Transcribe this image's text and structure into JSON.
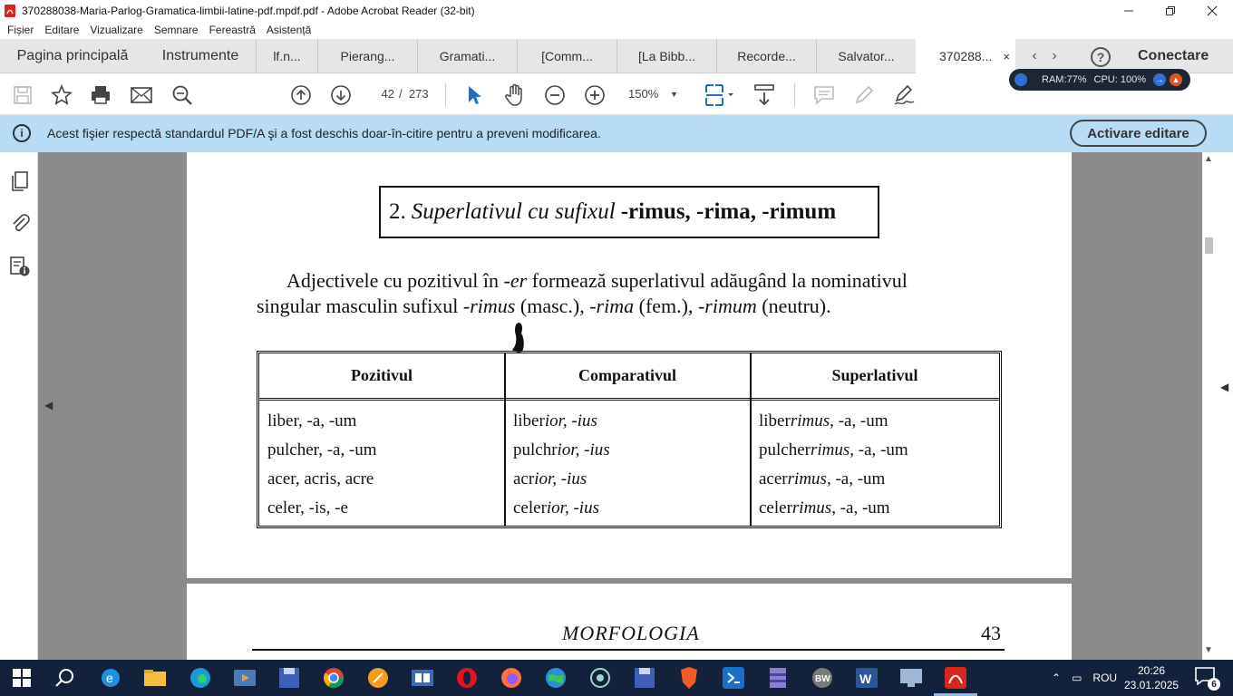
{
  "window": {
    "title": "370288038-Maria-Parlog-Gramatica-limbii-latine-pdf.mpdf.pdf - Adobe Acrobat Reader (32-bit)"
  },
  "menu": [
    "Fișier",
    "Editare",
    "Vizualizare",
    "Semnare",
    "Fereastră",
    "Asistență"
  ],
  "tabs": {
    "home": "Pagina principală",
    "tools": "Instrumente",
    "documents": [
      "lf.n...",
      "Pierang...",
      "Gramati...",
      "[Comm...",
      "[La Bibb...",
      "Recorde...",
      "Salvator...",
      "370288..."
    ],
    "active_index": 7,
    "close_glyph": "×",
    "connect": "Conectare"
  },
  "toolbar": {
    "page_current": "42",
    "page_sep": "/",
    "page_total": "273",
    "zoom": "150%"
  },
  "sysmon": {
    "ram": "RAM:77%",
    "cpu": "CPU: 100%"
  },
  "banner": {
    "message": "Acest fişier respectă standardul PDF/A şi a fost deschis doar-în-citire pentru a preveni modificarea.",
    "button": "Activare editare"
  },
  "page1": {
    "heading_num": "2.",
    "heading_italic": "Superlativul cu sufixul",
    "heading_bold": "-rimus, -rima, -rimum",
    "para": {
      "l1_a": "Adjectivele cu pozitivul în ",
      "l1_b": "-er",
      "l1_c": " formează superlativul adăugând la nominativul",
      "l2_a": "singular masculin sufixul ",
      "l2_b": "-rimus",
      "l2_c": " (masc.), ",
      "l2_d": "-rima",
      "l2_e": " (fem.), ",
      "l2_f": "-rimum",
      "l2_g": " (neutru)."
    },
    "table": {
      "headers": [
        "Pozitivul",
        "Comparativul",
        "Superlativul"
      ],
      "rows": [
        {
          "pos": "liber, -a, -um",
          "comp_stem": "liber",
          "comp_suf": "ior, -ius",
          "sup_stem": "liber",
          "sup_suf": "rimus",
          "sup_end": ", -a, -um"
        },
        {
          "pos": "pulcher, -a, -um",
          "comp_stem": "pulchr",
          "comp_suf": "ior, -ius",
          "sup_stem": "pulcher",
          "sup_suf": "rimus",
          "sup_end": ", -a, -um"
        },
        {
          "pos": "acer, acris, acre",
          "comp_stem": "acr",
          "comp_suf": "ior, -ius",
          "sup_stem": "acer",
          "sup_suf": "rimus",
          "sup_end": ", -a, -um"
        },
        {
          "pos": "celer, -is, -e",
          "comp_stem": "celer",
          "comp_suf": "ior, -ius",
          "sup_stem": "celer",
          "sup_suf": "rimus",
          "sup_end": ", -a, -um"
        }
      ]
    }
  },
  "page2": {
    "running_title": "MORFOLOGIA",
    "page_number": "43"
  },
  "taskbar": {
    "language": "ROU",
    "time": "20:26",
    "date": "23.01.2025",
    "notifications": "6"
  }
}
